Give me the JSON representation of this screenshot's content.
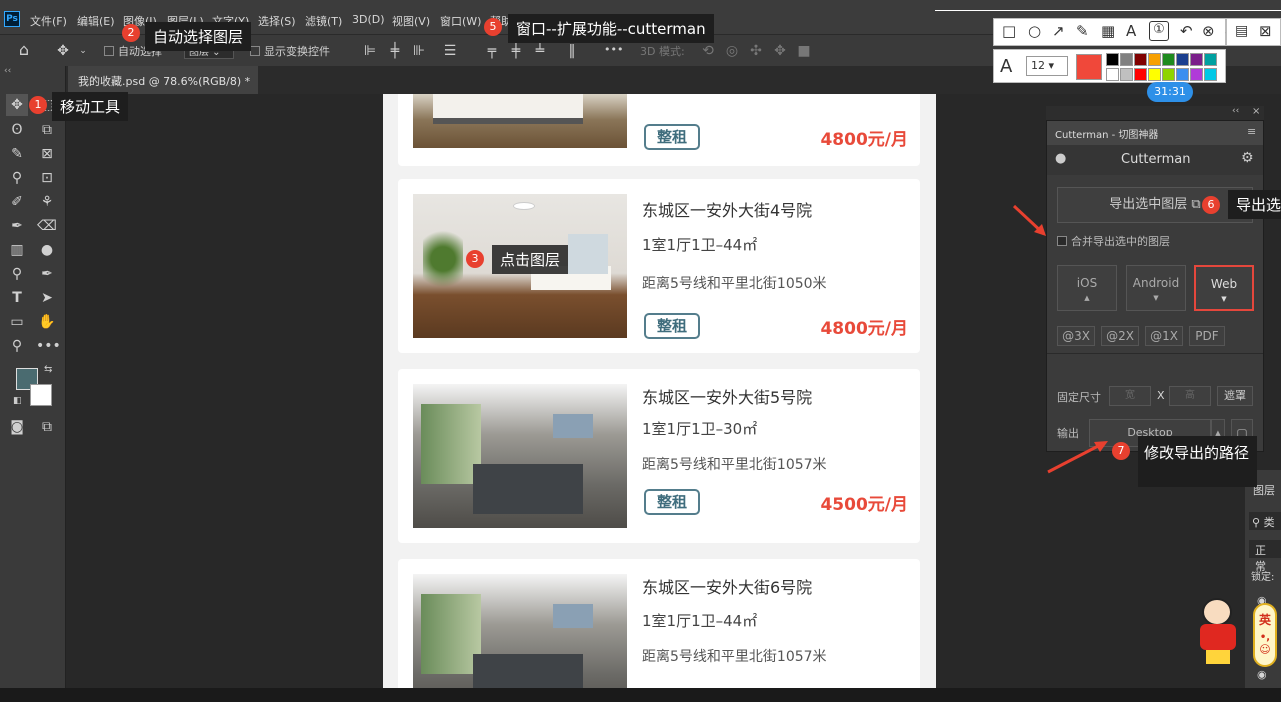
{
  "menubar": {
    "logo": "Ps",
    "items": [
      "文件(F)",
      "编辑(E)",
      "图像(I)",
      "图层(L)",
      "文字(Y)",
      "选择(S)",
      "滤镜(T)",
      "3D(D)",
      "视图(V)",
      "窗口(W)",
      "帮助(H)"
    ]
  },
  "optbar": {
    "auto_select_label": "自动选择",
    "layer_select_value": "图层",
    "show_transform_label": "显示变换控件",
    "mode_3d_label": "3D 模式:",
    "more_label": "•••"
  },
  "tab": {
    "doc_title": "我的收藏.psd @ 78.6%(RGB/8) *",
    "close_glyph": "×",
    "collapse_glyph": "‹‹"
  },
  "listings": [
    {
      "title": "",
      "size": "",
      "distance": "",
      "tag": "整租",
      "price": "4800元/月"
    },
    {
      "title": "东城区一安外大街4号院",
      "size": "1室1厅1卫–44㎡",
      "distance": "距离5号线和平里北街1050米",
      "tag": "整租",
      "price": "4800元/月"
    },
    {
      "title": "东城区一安外大街5号院",
      "size": "1室1厅1卫–30㎡",
      "distance": "距离5号线和平里北街1057米",
      "tag": "整租",
      "price": "4500元/月"
    },
    {
      "title": "东城区一安外大街6号院",
      "size": "1室1厅1卫–44㎡",
      "distance": "距离5号线和平里北街1057米",
      "tag": "",
      "price": ""
    }
  ],
  "cutterman": {
    "header": "Cutterman - 切图神器",
    "user_title": "Cutterman",
    "export_button": "导出选中图层",
    "merge_label": "合并导出选中的图层",
    "platforms": [
      "iOS",
      "Android",
      "Web"
    ],
    "selected_platform": "Web",
    "scales": [
      "@3X",
      "@2X",
      "@1X",
      "PDF"
    ],
    "fixed_size_label": "固定尺寸",
    "width_placeholder": "宽",
    "x_label": "X",
    "height_placeholder": "高",
    "mask_button": "遮罩",
    "output_label": "输出",
    "output_value": "Desktop"
  },
  "right_strip": {
    "layers_label": "图层",
    "search_label": "类",
    "blend_mode": "正常",
    "lock_label": "锁定:"
  },
  "overlay": {
    "timer": "31:31",
    "font_size": "12",
    "callouts": [
      {
        "num": "1",
        "text": "移动工具"
      },
      {
        "num": "2",
        "text": "自动选择图层"
      },
      {
        "num": "3",
        "text": "点击图层"
      },
      {
        "num": "5",
        "text": "窗口--扩展功能--cutterman"
      },
      {
        "num": "6",
        "text": "导出选"
      },
      {
        "num": "7",
        "text": "修改导出的路径"
      }
    ],
    "swatches": [
      "#000000",
      "#808080",
      "#800000",
      "#f7a000",
      "#1e8a1e",
      "#1b3f8f",
      "#7a1f8a",
      "#00a0a0",
      "#ffffff",
      "#c0c0c0",
      "#ff0000",
      "#ffff00",
      "#8fd400",
      "#3b8ef0",
      "#b03ad8",
      "#00c8e6"
    ],
    "current_color": "#f0483a",
    "ime_label": "英"
  },
  "colors": {
    "accent_red": "#e84a3a",
    "tag_blue": "#3f6d7d",
    "web_highlight": "#e5473c"
  }
}
